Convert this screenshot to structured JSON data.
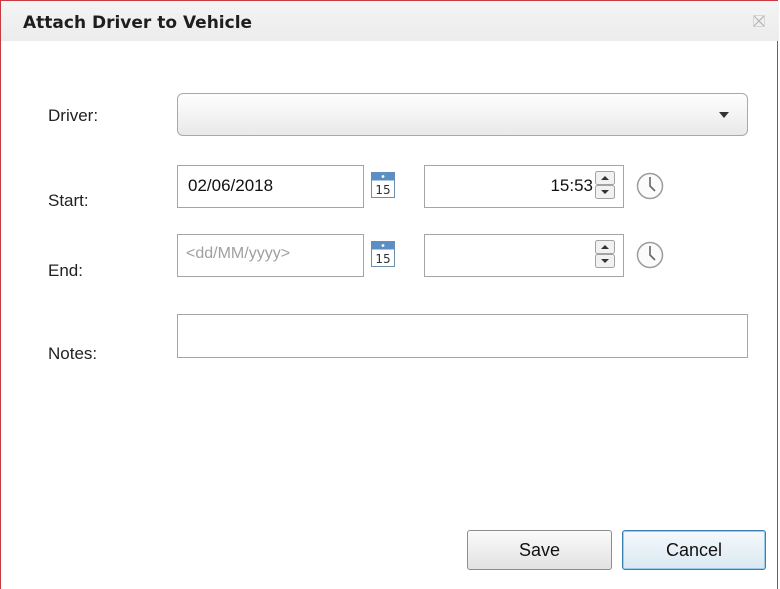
{
  "window": {
    "title": "Attach Driver to Vehicle"
  },
  "form": {
    "driver_label": "Driver:",
    "driver_value": "",
    "start_label": "Start:",
    "start_date": "02/06/2018",
    "start_time": "15:53",
    "end_label": "End:",
    "end_date_placeholder": "<dd/MM/yyyy>",
    "end_time": "",
    "notes_label": "Notes:",
    "notes_value": "",
    "calendar_day": "15"
  },
  "buttons": {
    "save": "Save",
    "cancel": "Cancel"
  },
  "colors": {
    "border_accent": "#c9393f",
    "focus": "#3c7fb1"
  }
}
